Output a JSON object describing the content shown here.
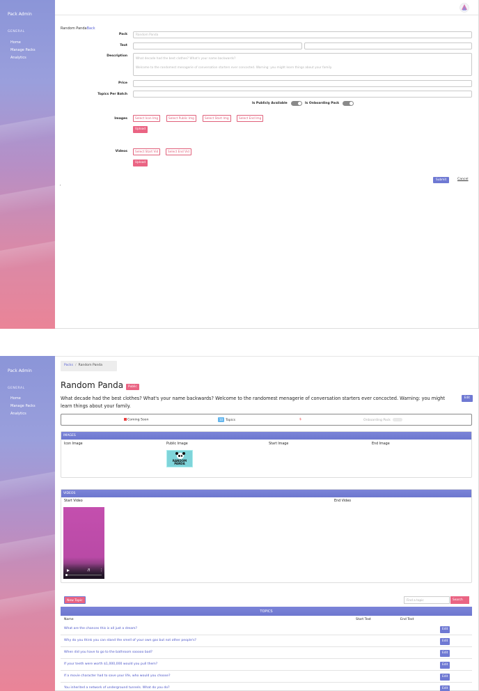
{
  "app": {
    "title": "Pack Admin"
  },
  "sidebar": {
    "section": "GENERAL",
    "items": [
      {
        "label": "Home"
      },
      {
        "label": "Manage Packs"
      },
      {
        "label": "Analytics"
      }
    ]
  },
  "form": {
    "crumb_title": "Random Panda",
    "crumb_back": "Back",
    "labels": {
      "pack": "Pack",
      "text": "Text",
      "description": "Description",
      "price": "Price",
      "topics_per_batch": "Topics Per Batch",
      "images": "Images",
      "videos": "Videos"
    },
    "pack_placeholder": "Random Panda",
    "description_line1": "What decade had the best clothes? What's your name backwards?",
    "description_line2": "Welcome to the randomest menagerie of conversation starters ever concocted. Warning: you might learn things about your family.",
    "toggle_public": "Is Publicly Available",
    "toggle_onboarding": "Is Onboarding Pack",
    "image_buttons": [
      "Select Icon Img",
      "Select Public Img",
      "Select Start Img",
      "Select End Img"
    ],
    "video_buttons": [
      "Select Start Vid",
      "Select End Vid"
    ],
    "upload": "Upload",
    "submit": "Submit",
    "cancel": "Cancel",
    "stray": ","
  },
  "detail": {
    "breadcrumb": {
      "root": "Packs",
      "sep": "/",
      "current": "Random Panda"
    },
    "title": "Random Panda",
    "badge": "Public",
    "description": "What decade had the best clothes? What's your name backwards? Welcome to the randomest menagerie of conversation starters ever concocted. Warning: you might learn things about your family.",
    "edit": "Edit",
    "status": {
      "coming_soon": "Coming Soon",
      "topics": "Topics",
      "topics_count": "10",
      "price": "$",
      "onboarding": "Onboarding Pack"
    },
    "images": {
      "header": "IMAGES",
      "columns": [
        "Icon Image",
        "Public Image",
        "Start Image",
        "End Image"
      ],
      "public_image_text": "RANDOM PANDA"
    },
    "videos": {
      "header": "VIDEOS",
      "columns": [
        "Start Video",
        "End Video"
      ]
    },
    "topics": {
      "new_topic": "New Topic",
      "find_placeholder": "Find a topic",
      "search": "Search",
      "header": "TOPICS",
      "columns": [
        "Name",
        "Start Text",
        "End Text"
      ],
      "edit": "Edit",
      "rows": [
        "What are the chances this is all just a dream?",
        "Why do you think you can stand the smell of your own gas but not other people's?",
        "When did you have to go to the bathroom sooooo bad?",
        "If your teeth were worth $1,000,000 would you pull them?",
        "If a movie character had to save your life, who would you choose?",
        "You inherited a network of underground tunnels. What do you do?"
      ]
    }
  },
  "colors": {
    "accent_blue": "#6f79d3",
    "accent_pink": "#ea6483"
  }
}
